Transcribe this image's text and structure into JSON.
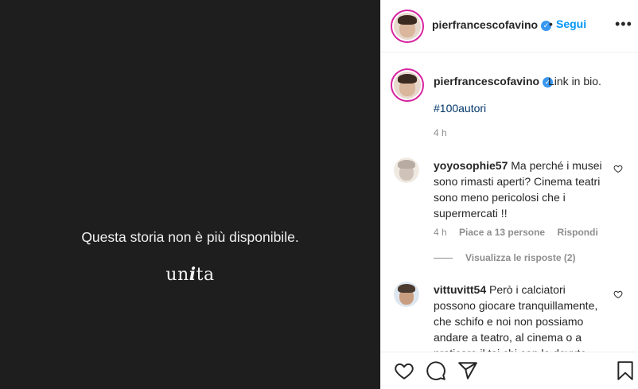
{
  "media": {
    "message": "Questa storia non è più disponibile.",
    "brand": {
      "prefix": "un",
      "accent": "i",
      "suffix": "ta"
    }
  },
  "header": {
    "username": "pierfrancescofavino",
    "separator": "•",
    "follow_label": "Segui",
    "more_label": "•••"
  },
  "caption": {
    "username": "pierfrancescofavino",
    "text": "Link in bio.",
    "hashtag": "#100autori",
    "time": "4 h"
  },
  "comments": [
    {
      "username": "yoyosophie57",
      "text": "Ma perché i musei sono rimasti aperti? Cinema teatri sono meno pericolosi che i supermercati !!",
      "time": "4 h",
      "likes": "Piace a 13 persone",
      "reply_label": "Rispondi",
      "view_replies": "Visualizza le risposte (2)"
    },
    {
      "username": "vittuvitt54",
      "text": "Però i calciatori possono giocare tranquillamente, che schifo e noi non possiamo andare a teatro, al cinema o a praticare il tai chi con le dovute"
    }
  ],
  "colors": {
    "media_bg": "#1e1e1e",
    "follow": "#0095f6",
    "verified": "#3897f0",
    "hashtag": "#00376b",
    "muted": "#8e8e8e"
  },
  "icons": [
    "verified-badge-icon",
    "heart-icon",
    "comment-icon",
    "share-icon",
    "bookmark-icon"
  ]
}
